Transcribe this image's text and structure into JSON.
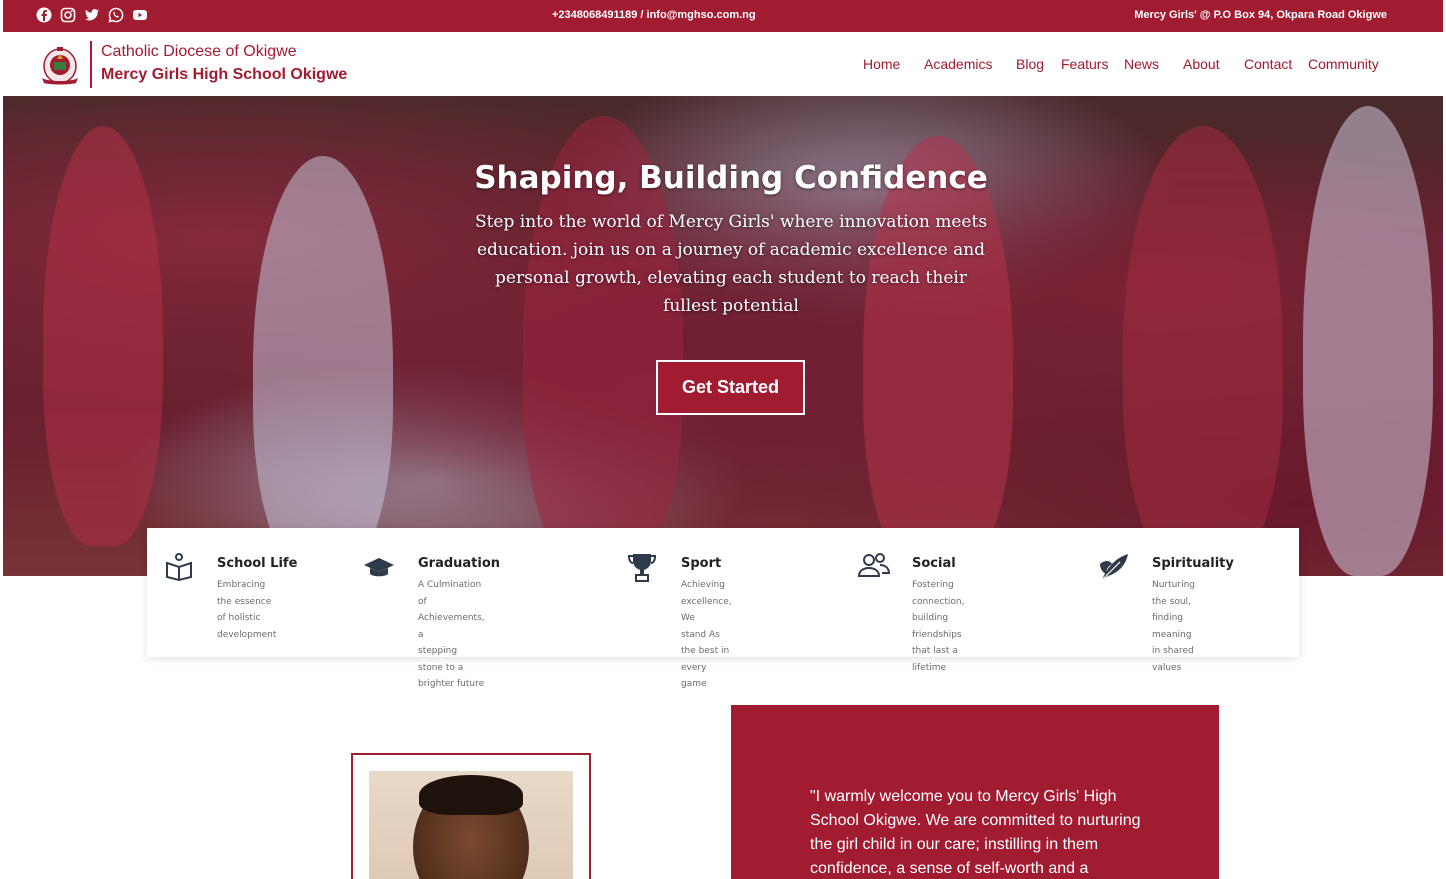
{
  "topbar": {
    "contact": "+2348068491189 / info@mghso.com.ng",
    "address": "Mercy Girls' @ P.O Box 94, Okpara Road Okigwe",
    "socials": [
      "facebook-icon",
      "instagram-icon",
      "twitter-icon",
      "whatsapp-icon",
      "youtube-icon"
    ]
  },
  "header": {
    "brand_top": "Catholic Diocese of Okigwe",
    "brand_bottom": "Mercy Girls High School Okigwe",
    "nav": [
      "Home",
      "Academics",
      "Blog",
      "Featurs",
      "News",
      "About",
      "Contact",
      "Community"
    ]
  },
  "hero": {
    "title": "Shaping, Building Confidence",
    "text": "Step into the world of Mercy Girls' where innovation meets education. join us on a journey of academic excellence and personal growth, elevating each student to reach their fullest potential",
    "button": "Get Started"
  },
  "features": [
    {
      "icon": "open-book-icon",
      "title": "School Life",
      "line1": "Embracing the essence",
      "line2": "of holistic development",
      "line3": ""
    },
    {
      "icon": "graduation-cap-icon",
      "title": "Graduation",
      "line1": "A Culmination of Achievements, a",
      "line2": "stepping stone to a brighter future",
      "line3": ""
    },
    {
      "icon": "trophy-icon",
      "title": "Sport",
      "line1": "Achieving excellence, We",
      "line2": "stand As the best in every",
      "line3": "game"
    },
    {
      "icon": "people-icon",
      "title": "Social",
      "line1": "Fostering connection, building",
      "line2": "friendships that last a lifetime",
      "line3": ""
    },
    {
      "icon": "feather-icon",
      "title": "Spirituality",
      "line1": "Nurturing the soul, finding",
      "line2": "meaning in shared values",
      "line3": ""
    }
  ],
  "welcome": {
    "text": "\"I warmly welcome you to Mercy Girls' High School Okigwe. We are committed to nurturing the girl child in our care; instilling in them confidence, a sense of self-worth and a"
  },
  "colors": {
    "brand": "#a11b31",
    "white": "#ffffff"
  }
}
